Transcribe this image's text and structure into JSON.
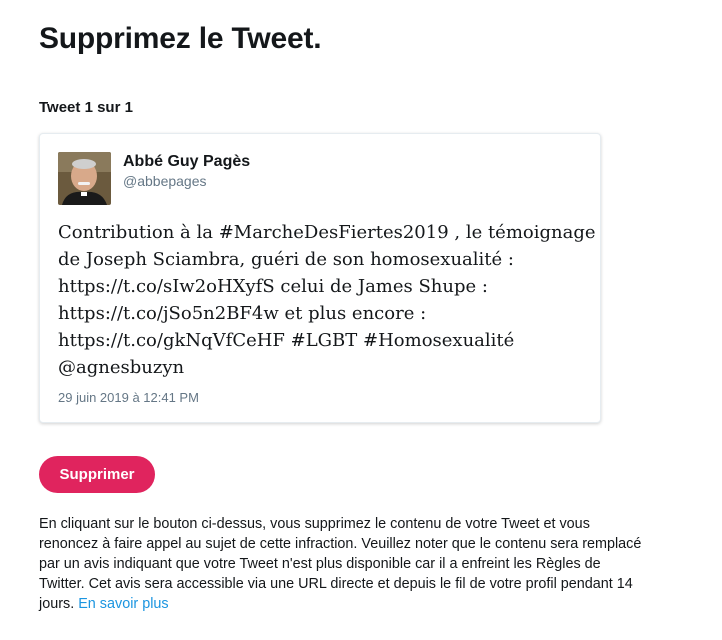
{
  "page": {
    "title": "Supprimez le Tweet.",
    "tweet_count": "Tweet 1 sur 1"
  },
  "tweet": {
    "author_name": "Abbé Guy Pagès",
    "author_handle": "@abbepages",
    "text_lines": [
      "Contribution à la #MarcheDesFiertes2019 , le témoignage",
      "de Joseph Sciambra, guéri de son homosexualité :",
      "https://t.co/sIw2oHXyfS celui de James Shupe :",
      "https://t.co/jSo5n2BF4w et plus encore :",
      "https://t.co/gkNqVfCeHF #LGBT #Homosexualité",
      "@agnesbuzyn"
    ],
    "date": "29 juin 2019 à 12:41 PM"
  },
  "actions": {
    "delete_label": "Supprimer"
  },
  "notice": {
    "lines": [
      "En cliquant sur le bouton ci-dessus, vous supprimez le contenu de votre Tweet et vous",
      "renoncez à faire appel au sujet de cette infraction. Veuillez noter que le contenu sera remplacé",
      "par un avis indiquant que votre Tweet n'est plus disponible car il a enfreint les Règles de",
      "Twitter. Cet avis sera accessible via une URL directe et depuis le fil de votre profil pendant 14"
    ],
    "last_line": "jours.",
    "learn_more": "En savoir plus"
  },
  "colors": {
    "accent": "#e0245e",
    "link": "#1b95e0",
    "secondary_text": "#657786"
  },
  "icons": {
    "avatar": "avatar-photo"
  }
}
